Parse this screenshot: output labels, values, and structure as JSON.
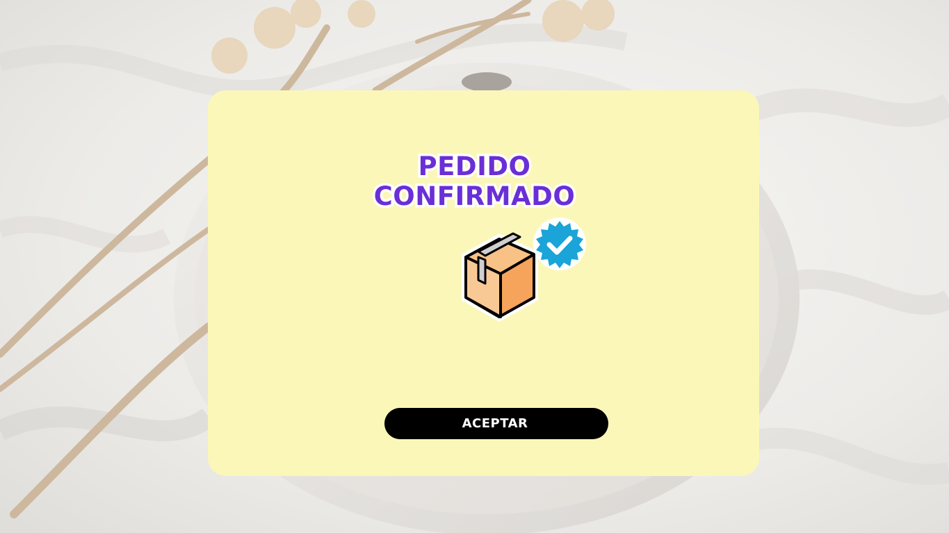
{
  "dialog": {
    "title_line1": "PEDIDO",
    "title_line2": "CONFIRMADO",
    "illustration_icon": "package-box-icon",
    "badge_icon": "verified-check-badge-icon",
    "accept_label": "ACEPTAR"
  },
  "colors": {
    "panel_background": "#fbf7b9",
    "title_purple": "#6a2fd6",
    "button_background": "#000000",
    "button_text": "#ffffff",
    "box_orange": "#f6a35c",
    "badge_blue": "#1aa4d8"
  }
}
